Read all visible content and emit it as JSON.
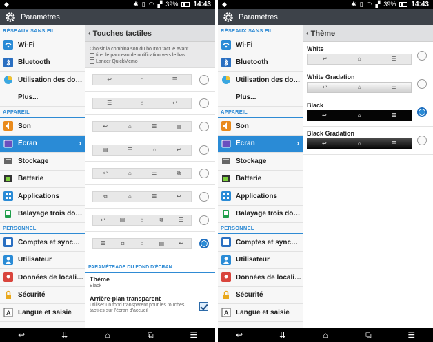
{
  "status": {
    "battery": "39%",
    "time": "14:43"
  },
  "left": {
    "title": "Paramètres",
    "sections": {
      "reseaux": "RÉSEAUX SANS FIL",
      "appareil": "APPAREIL",
      "personnel": "PERSONNEL"
    },
    "items": {
      "wifi": "Wi-Fi",
      "bluetooth": "Bluetooth",
      "data": "Utilisation des donn…",
      "plus": "Plus...",
      "son": "Son",
      "ecran": "Écran",
      "stockage": "Stockage",
      "batterie": "Batterie",
      "applications": "Applications",
      "balayage": "Balayage trois doigts",
      "comptes": "Comptes et synchro…",
      "utilisateur": "Utilisateur",
      "localisation": "Données de localisat…",
      "securite": "Sécurité",
      "langue": "Langue et saisie"
    },
    "detail": {
      "header": "Touches tactiles",
      "description": [
        "Choisir la combinaison du bouton tact le avant",
        "tirer le panneau de notification vers le bas",
        "Lancer QuickMemo"
      ],
      "combos": [
        [
          "↩",
          "⌂",
          "☰"
        ],
        [
          "☰",
          "⌂",
          "↩"
        ],
        [
          "↩",
          "⌂",
          "☰",
          "▤"
        ],
        [
          "▤",
          "☰",
          "⌂",
          "↩"
        ],
        [
          "↩",
          "⌂",
          "☰",
          "⧉"
        ],
        [
          "⧉",
          "⌂",
          "☰",
          "↩"
        ],
        [
          "↩",
          "▤",
          "⌂",
          "⧉",
          "☰"
        ],
        [
          "☰",
          "⧉",
          "⌂",
          "▤",
          "↩"
        ]
      ],
      "selected_combo": 7,
      "section": "PARAMÉTRAGE DU FOND D'ÉCRAN",
      "theme_title": "Thème",
      "theme_value": "Black",
      "transparent_title": "Arrière-plan transparent",
      "transparent_desc": "Utiliser un fond transparent pour les touches tactiles sur l'écran d'accueil",
      "transparent_checked": true
    }
  },
  "right": {
    "title": "Paramètres",
    "header": "Thème",
    "themes": [
      "White",
      "White Gradation",
      "Black",
      "Black Gradation"
    ],
    "selected_theme": 2
  },
  "nav": {
    "back": "↩",
    "notif": "⇊",
    "home": "⌂",
    "memo": "⧉",
    "menu": "☰"
  },
  "colors": {
    "accent": "#2a8bd6",
    "actionbar": "#3d4249"
  }
}
